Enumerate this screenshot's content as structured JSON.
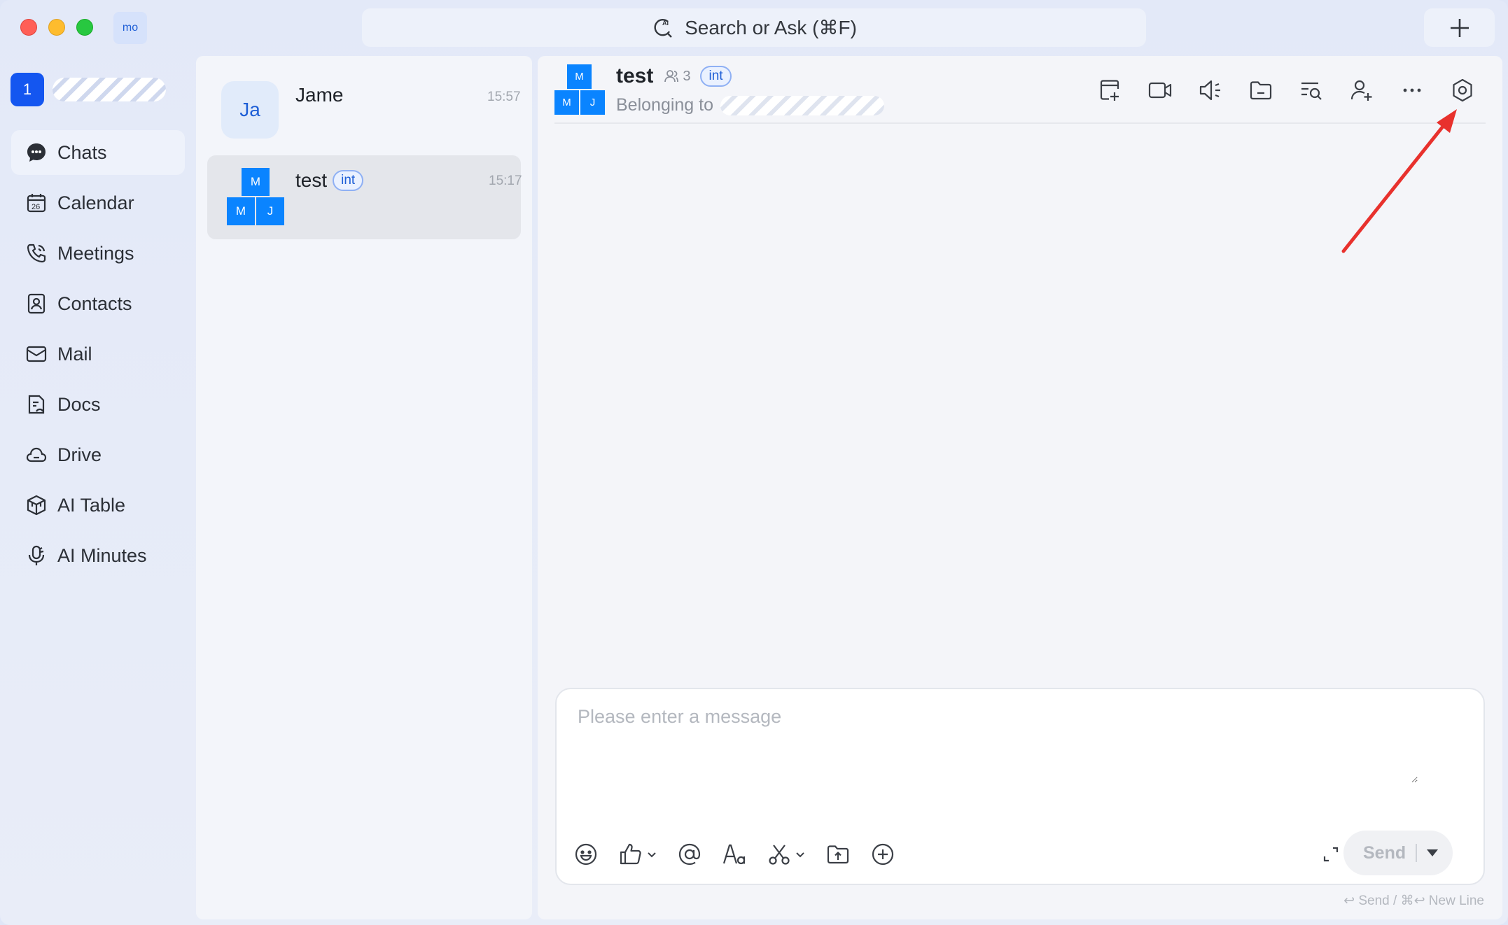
{
  "window": {
    "workspace_badge": "mo",
    "search_placeholder": "Search or Ask  (⌘F)"
  },
  "nav": {
    "org_badge": "1",
    "items": [
      {
        "label": "Chats",
        "icon": "chat-bubble-icon",
        "active": true
      },
      {
        "label": "Calendar",
        "icon": "calendar-icon",
        "active": false
      },
      {
        "label": "Meetings",
        "icon": "phone-icon",
        "active": false
      },
      {
        "label": "Contacts",
        "icon": "contact-card-icon",
        "active": false
      },
      {
        "label": "Mail",
        "icon": "mail-icon",
        "active": false
      },
      {
        "label": "Docs",
        "icon": "docs-icon",
        "active": false
      },
      {
        "label": "Drive",
        "icon": "cloud-icon",
        "active": false
      },
      {
        "label": "AI Table",
        "icon": "cube-icon",
        "active": false
      },
      {
        "label": "AI Minutes",
        "icon": "microphone-icon",
        "active": false
      }
    ]
  },
  "chat_list": [
    {
      "name": "Jame",
      "avatar_text": "Ja",
      "time": "15:57"
    },
    {
      "name": "test",
      "tag": "int",
      "time": "15:17",
      "avatar_tiles": [
        "M",
        "M",
        "J"
      ]
    }
  ],
  "conversation": {
    "title": "test",
    "member_count": "3",
    "tag": "int",
    "belonging_label": "Belonging to",
    "avatar_tiles": [
      "M",
      "M",
      "J"
    ],
    "toolbar": [
      "add-tab-icon",
      "video-icon",
      "announcement-icon",
      "folder-icon",
      "search-history-icon",
      "add-member-icon",
      "more-icon",
      "settings-icon"
    ]
  },
  "composer": {
    "placeholder": "Please enter a message",
    "send_label": "Send",
    "hint": "↩ Send / ⌘↩ New Line"
  },
  "colors": {
    "accent": "#1456f0",
    "avatar_blue": "#0a84ff",
    "annotation_arrow": "#e8312d"
  }
}
